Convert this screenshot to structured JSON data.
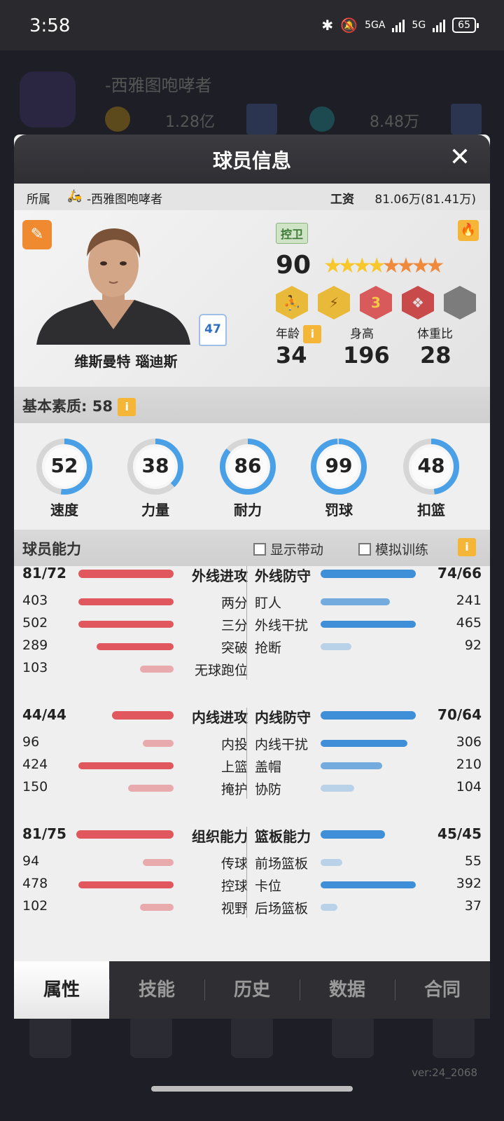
{
  "status_bar": {
    "time": "3:58",
    "network1": "5GA",
    "network2": "5G",
    "battery": "65"
  },
  "background": {
    "team_name": "-西雅图咆哮者",
    "amount1": "1.28亿",
    "amount2": "8.48万",
    "version": "ver:24_2068"
  },
  "modal": {
    "title": "球员信息",
    "team_label": "所属",
    "team_name": "-西雅图咆哮者",
    "salary_label": "工资",
    "salary_value": "81.06万(81.41万)",
    "player_name": "维斯曼特 瑙迪斯",
    "jersey_number": "47",
    "position": "控卫",
    "rating": "90",
    "stars": {
      "gold": 4,
      "orange": 4
    },
    "badge_numbers": [
      "3"
    ],
    "age_label": "年龄",
    "age_value": "34",
    "height_label": "身高",
    "height_value": "196",
    "weight_label": "体重比",
    "weight_value": "28"
  },
  "basic": {
    "title": "基本素质: 58",
    "stats": [
      {
        "name": "速度",
        "value": 52
      },
      {
        "name": "力量",
        "value": 38
      },
      {
        "name": "耐力",
        "value": 86
      },
      {
        "name": "罚球",
        "value": 99
      },
      {
        "name": "扣篮",
        "value": 48
      }
    ]
  },
  "ability": {
    "title": "球员能力",
    "show_lead_label": "显示带动",
    "sim_training_label": "模拟训练",
    "groups": [
      {
        "left_head": {
          "name": "外线进攻",
          "value": "81/72",
          "fraction": 0.8
        },
        "right_head": {
          "name": "外线防守",
          "value": "74/66",
          "fraction": 0.8
        },
        "left": [
          {
            "name": "两分",
            "value": "403",
            "fraction": 0.8
          },
          {
            "name": "三分",
            "value": "502",
            "fraction": 0.8
          },
          {
            "name": "突破",
            "value": "289",
            "fraction": 0.65
          },
          {
            "name": "无球跑位",
            "value": "103",
            "fraction": 0.28
          }
        ],
        "right": [
          {
            "name": "盯人",
            "value": "241",
            "fraction": 0.58
          },
          {
            "name": "外线干扰",
            "value": "465",
            "fraction": 0.8
          },
          {
            "name": "抢断",
            "value": "92",
            "fraction": 0.26
          }
        ]
      },
      {
        "left_head": {
          "name": "内线进攻",
          "value": "44/44",
          "fraction": 0.52
        },
        "right_head": {
          "name": "内线防守",
          "value": "70/64",
          "fraction": 0.8
        },
        "left": [
          {
            "name": "内投",
            "value": "96",
            "fraction": 0.26
          },
          {
            "name": "上篮",
            "value": "424",
            "fraction": 0.8
          },
          {
            "name": "掩护",
            "value": "150",
            "fraction": 0.38
          }
        ],
        "right": [
          {
            "name": "内线干扰",
            "value": "306",
            "fraction": 0.73
          },
          {
            "name": "盖帽",
            "value": "210",
            "fraction": 0.52
          },
          {
            "name": "协防",
            "value": "104",
            "fraction": 0.28
          }
        ]
      },
      {
        "left_head": {
          "name": "组织能力",
          "value": "81/75",
          "fraction": 0.82
        },
        "right_head": {
          "name": "篮板能力",
          "value": "45/45",
          "fraction": 0.54
        },
        "left": [
          {
            "name": "传球",
            "value": "94",
            "fraction": 0.26
          },
          {
            "name": "控球",
            "value": "478",
            "fraction": 0.8
          },
          {
            "name": "视野",
            "value": "102",
            "fraction": 0.28
          }
        ],
        "right": [
          {
            "name": "前场篮板",
            "value": "55",
            "fraction": 0.18
          },
          {
            "name": "卡位",
            "value": "392",
            "fraction": 0.8
          },
          {
            "name": "后场篮板",
            "value": "37",
            "fraction": 0.14
          }
        ]
      }
    ]
  },
  "tabs": [
    "属性",
    "技能",
    "历史",
    "数据",
    "合同"
  ],
  "colors": {
    "red_bar": "#e0575d",
    "blue_bar": "#3f8fd8",
    "ring_blue": "#4aa0e6",
    "accent_orange": "#f08a30"
  }
}
